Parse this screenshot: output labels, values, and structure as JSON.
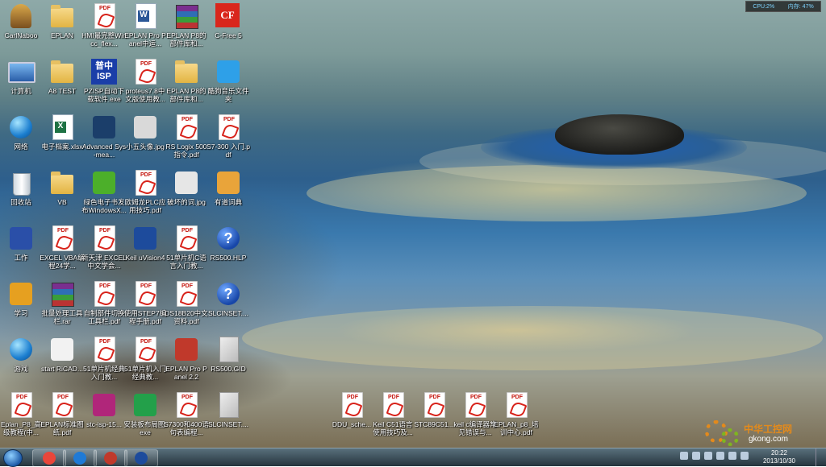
{
  "system_monitor": {
    "cpu": "CPU:2%",
    "mem": "内存: 47%"
  },
  "icons": [
    {
      "label": "CarlNaboo",
      "type": "person"
    },
    {
      "label": "EPLAN",
      "type": "folder"
    },
    {
      "label": "HMI最完整Wincc_flex...",
      "type": "pdf"
    },
    {
      "label": "EPLAN Pro Panel中运...",
      "type": "word"
    },
    {
      "label": "EPLAN P8的部件库和...",
      "type": "rar"
    },
    {
      "label": "C-Free 5",
      "type": "cf"
    },
    {
      "label": "计算机",
      "type": "pc"
    },
    {
      "label": "A8 TEST",
      "type": "folder"
    },
    {
      "label": "PZISP自动下载软件.exe",
      "type": "isp"
    },
    {
      "label": "proteus7.8中文版使用教...",
      "type": "pdf"
    },
    {
      "label": "EPLAN P8的部件库和...",
      "type": "folder"
    },
    {
      "label": "酷狗音乐文件夹",
      "type": "gen",
      "color": "#2ea0e8"
    },
    {
      "label": "网络",
      "type": "globe"
    },
    {
      "label": "电子档案.xlsx",
      "type": "excel"
    },
    {
      "label": "Advanced Sys-mea...",
      "type": "gen",
      "color": "#1b3e6a"
    },
    {
      "label": "小五头像.jpg",
      "type": "gen",
      "color": "#d9d9d9"
    },
    {
      "label": "RS Logix 500指令.pdf",
      "type": "pdf"
    },
    {
      "label": "S7-300 入门.pdf",
      "type": "pdf"
    },
    {
      "label": "回收站",
      "type": "trash"
    },
    {
      "label": "VB",
      "type": "folder"
    },
    {
      "label": "绿色电子书发布WindowsX...",
      "type": "gen",
      "color": "#4caf2a"
    },
    {
      "label": "欧姆龙PLC应用技巧.pdf",
      "type": "pdf"
    },
    {
      "label": "破坏的词.jpg",
      "type": "gen",
      "color": "#e6e6e6"
    },
    {
      "label": "有道词典",
      "type": "gen",
      "color": "#e9a43a"
    },
    {
      "label": "工作",
      "type": "gen",
      "color": "#2a4fa8"
    },
    {
      "label": "EXCEL VBA编程24学...",
      "type": "pdf"
    },
    {
      "label": "新天津 EXCEL中文学会...",
      "type": "pdf"
    },
    {
      "label": "Keil uVision4",
      "type": "gen",
      "color": "#1d4b9c"
    },
    {
      "label": "51单片机C语言入门教...",
      "type": "pdf"
    },
    {
      "label": "RS500.HLP",
      "type": "help"
    },
    {
      "label": "学习",
      "type": "gen",
      "color": "#e6a020"
    },
    {
      "label": "批量处理工具栏.rar",
      "type": "rar"
    },
    {
      "label": "自制部件切换工具栏.pdf",
      "type": "pdf"
    },
    {
      "label": "使用STEP7编程手册.pdf",
      "type": "pdf"
    },
    {
      "label": "DS18B20中文资料.pdf",
      "type": "pdf"
    },
    {
      "label": "SLCINSET....",
      "type": "help"
    },
    {
      "label": "游戏",
      "type": "globe"
    },
    {
      "label": "start RiCAD...",
      "type": "gen",
      "color": "#f2f2f2"
    },
    {
      "label": "51单片机经典入门教...",
      "type": "pdf"
    },
    {
      "label": "51单片机入门经典教...",
      "type": "pdf"
    },
    {
      "label": "EPLAN Pro Panel 2.2",
      "type": "gen",
      "color": "#c0392b"
    },
    {
      "label": "RS500.GID",
      "type": "blank"
    },
    {
      "label": "Eplan_P8_高级教程(中...",
      "type": "pdf"
    },
    {
      "label": "EPLAN标准图纸.pdf",
      "type": "pdf"
    },
    {
      "label": "stc-isp-15...",
      "type": "gen",
      "color": "#b0267a"
    },
    {
      "label": "安装板布局图.exe",
      "type": "gen",
      "color": "#23a04a"
    },
    {
      "label": "S7300和400语句表编程...",
      "type": "pdf"
    },
    {
      "label": "SLCINSET....",
      "type": "blank"
    },
    {
      "label": "DDU_sche...",
      "type": "pdf"
    },
    {
      "label": "Keil C51语言使用技巧及...",
      "type": "pdf"
    },
    {
      "label": "STC89C51...",
      "type": "pdf"
    },
    {
      "label": "keil c编译器常见错误与...",
      "type": "pdf"
    },
    {
      "label": "EPLAN_p8_培训中心.pdf",
      "type": "pdf"
    }
  ],
  "taskbar": {
    "buttons": [
      {
        "name": "chrome",
        "color": "#e9463a"
      },
      {
        "name": "ie",
        "color": "#1f7ad6"
      },
      {
        "name": "eplan",
        "color": "#c0392b"
      },
      {
        "name": "keil",
        "color": "#1d4b9c"
      }
    ],
    "time": "20:22",
    "date": "2013/10/30"
  },
  "watermark": {
    "site_cn": "中华工控网",
    "site": "gkong.com"
  }
}
